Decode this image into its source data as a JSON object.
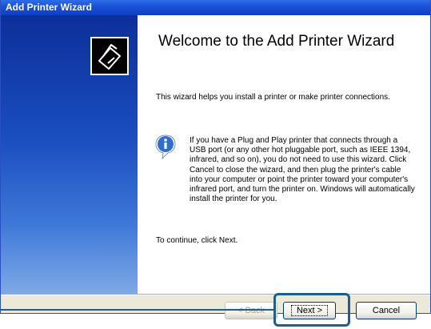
{
  "window": {
    "title": "Add Printer Wizard"
  },
  "content": {
    "heading": "Welcome to the Add Printer Wizard",
    "intro": "This wizard helps you install a printer or make printer connections.",
    "info_text": "If you have a Plug and Play printer that connects through a USB port (or any other hot pluggable port, such as IEEE 1394, infrared, and so on), you do not need to use this wizard. Click Cancel to close the wizard, and then plug the printer's cable into your computer or point the printer toward your computer's infrared port, and turn the printer on. Windows will automatically install the printer for you.",
    "continue": "To continue, click Next."
  },
  "buttons": {
    "back_label": "< Back",
    "next_label": "Next >",
    "cancel_label": "Cancel"
  },
  "icons": {
    "wizard_icon": "printer-wizard-icon",
    "info_icon": "info-icon"
  },
  "colors": {
    "titlebar": "#1c52d8",
    "sidebar_top": "#0c2f9a",
    "sidebar_bottom": "#7fa9e6",
    "highlight": "#1f5f8f"
  }
}
